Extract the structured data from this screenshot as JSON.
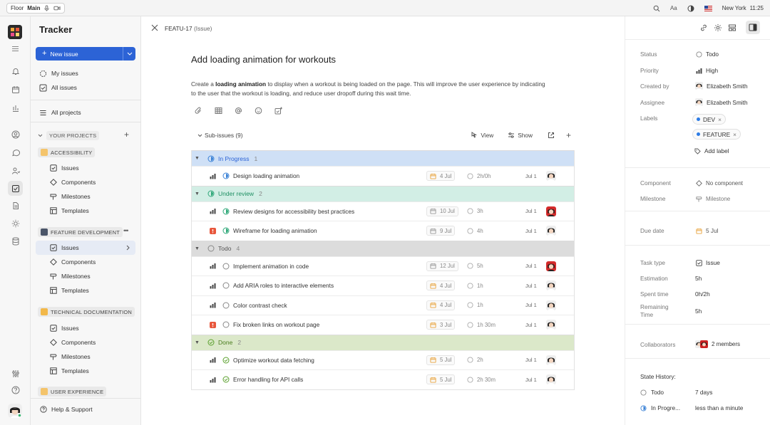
{
  "topbar": {
    "workspace": "Floor",
    "space": "Main",
    "location": "New York",
    "time": "11:25",
    "font_label": "Aa"
  },
  "sidebar": {
    "app_title": "Tracker",
    "new_issue": "New issue",
    "nav": [
      {
        "label": "My issues",
        "icon": "my-issues-icon"
      },
      {
        "label": "All issues",
        "icon": "all-issues-icon"
      },
      {
        "label": "All projects",
        "icon": "projects-icon"
      }
    ],
    "projects_header": "YOUR PROJECTS",
    "projects": [
      {
        "name": "ACCESSIBILITY",
        "items": [
          "Issues",
          "Components",
          "Milestones",
          "Templates"
        ]
      },
      {
        "name": "FEATURE DEVELOPMENT",
        "items": [
          "Issues",
          "Components",
          "Milestones",
          "Templates"
        ]
      },
      {
        "name": "TECHNICAL DOCUMENTATION",
        "items": [
          "Issues",
          "Components",
          "Milestones",
          "Templates"
        ]
      },
      {
        "name": "USER EXPERIENCE",
        "items": []
      }
    ],
    "help": "Help & Support"
  },
  "issue": {
    "id": "FEATU-17",
    "type": "(Issue)",
    "title": "Add loading animation for workouts",
    "desc_pre": "Create a ",
    "desc_bold": "loading animation",
    "desc_post": " to display when a workout is being loaded on the page. This will improve the user experience by indicating to the user that the workout is loading, and reduce user dropoff during this wait time.",
    "subissues_label": "Sub-issues (9)",
    "view_label": "View",
    "show_label": "Show"
  },
  "groups": [
    {
      "name": "In Progress",
      "count": "1",
      "color": "#cfe0f6",
      "status": "in-progress",
      "rows": [
        {
          "name": "Design loading animation",
          "due": "4 Jul",
          "est": "2h/0h",
          "date": "Jul 1",
          "pri": "bars",
          "warm": true
        }
      ]
    },
    {
      "name": "Under review",
      "count": "2",
      "color": "#d2eee5",
      "status": "under-review",
      "rows": [
        {
          "name": "Review designs for accessibility best practices",
          "due": "10 Jul",
          "est": "3h",
          "date": "Jul 1",
          "pri": "bars",
          "warm": false
        },
        {
          "name": "Wireframe for loading animation",
          "due": "9 Jul",
          "est": "4h",
          "date": "Jul 1",
          "pri": "urgent",
          "warm": true
        }
      ]
    },
    {
      "name": "Todo",
      "count": "4",
      "color": "#dcdcdc",
      "status": "todo",
      "rows": [
        {
          "name": "Implement animation in code",
          "due": "12 Jul",
          "est": "5h",
          "date": "Jul 1",
          "pri": "bars",
          "warm": false
        },
        {
          "name": "Add ARIA roles to interactive elements",
          "due": "4 Jul",
          "est": "1h",
          "date": "Jul 1",
          "pri": "bars",
          "warm": true
        },
        {
          "name": "Color contrast check",
          "due": "4 Jul",
          "est": "1h",
          "date": "Jul 1",
          "pri": "bars",
          "warm": true
        },
        {
          "name": "Fix broken links on workout page",
          "due": "3 Jul",
          "est": "1h 30m",
          "date": "Jul 1",
          "pri": "urgent",
          "warm": true
        }
      ]
    },
    {
      "name": "Done",
      "count": "2",
      "color": "#dbe8c9",
      "status": "done",
      "rows": [
        {
          "name": "Optimize workout data fetching",
          "due": "5 Jul",
          "est": "2h",
          "date": "Jul 1",
          "pri": "bars",
          "warm": true
        },
        {
          "name": "Error handling for API calls",
          "due": "5 Jul",
          "est": "2h 30m",
          "date": "Jul 1",
          "pri": "bars",
          "warm": true
        }
      ]
    }
  ],
  "props": {
    "status_l": "Status",
    "status_v": "Todo",
    "priority_l": "Priority",
    "priority_v": "High",
    "created_l": "Created by",
    "created_v": "Elizabeth Smith",
    "assignee_l": "Assignee",
    "assignee_v": "Elizabeth Smith",
    "labels_l": "Labels",
    "labels": [
      "DEV",
      "FEATURE"
    ],
    "add_label": "Add label",
    "component_l": "Component",
    "component_v": "No component",
    "milestone_l": "Milestone",
    "milestone_v": "Milestone",
    "due_l": "Due date",
    "due_v": "5 Jul",
    "tasktype_l": "Task type",
    "tasktype_v": "Issue",
    "estimation_l": "Estimation",
    "estimation_v": "5h",
    "spent_l": "Spent time",
    "spent_v": "0h/2h",
    "remaining_l1": "Remaining",
    "remaining_l2": "Time",
    "remaining_v": "5h",
    "collab_l": "Collaborators",
    "collab_v": "2 members",
    "history_l": "State History:",
    "history": [
      {
        "state": "Todo",
        "time": "7 days"
      },
      {
        "state": "In Progre...",
        "time": "less than a minute"
      }
    ]
  },
  "colors": {
    "accent": "#2c63d6",
    "inprogress": "#3b82d6",
    "review": "#2fa879",
    "done": "#5aa02c",
    "urgent": "#e8573c"
  }
}
